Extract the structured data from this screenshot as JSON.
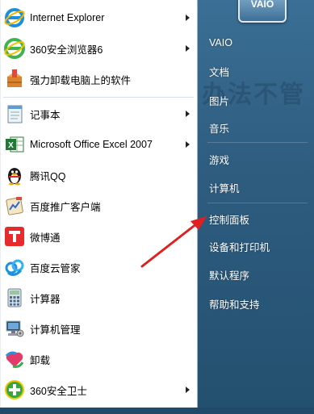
{
  "programs": [
    {
      "label": "Internet Explorer",
      "icon": "internet-explorer-icon",
      "arrow": true
    },
    {
      "label": "360安全浏览器6",
      "icon": "360-browser-icon",
      "arrow": true
    },
    {
      "label": "强力卸载电脑上的软件",
      "icon": "uninstall-box-icon",
      "arrow": false
    },
    {
      "label": "记事本",
      "icon": "notepad-icon",
      "arrow": true
    },
    {
      "label": "Microsoft Office Excel 2007",
      "icon": "excel-icon",
      "arrow": true
    },
    {
      "label": "腾讯QQ",
      "icon": "qq-penguin-icon",
      "arrow": false
    },
    {
      "label": "百度推广客户端",
      "icon": "baidu-promo-icon",
      "arrow": false
    },
    {
      "label": "微博通",
      "icon": "weibotong-icon",
      "arrow": false
    },
    {
      "label": "百度云管家",
      "icon": "baidu-cloud-icon",
      "arrow": false
    },
    {
      "label": "计算器",
      "icon": "calculator-icon",
      "arrow": false
    },
    {
      "label": "计算机管理",
      "icon": "computer-management-icon",
      "arrow": false
    },
    {
      "label": "卸载",
      "icon": "uninstall-heart-icon",
      "arrow": false
    },
    {
      "label": "360安全卫士",
      "icon": "360-safe-icon",
      "arrow": true
    }
  ],
  "right_panel": {
    "avatar_text": "VAIO",
    "items": [
      {
        "label": "VAIO"
      },
      {
        "label": "文档"
      },
      {
        "label": "图片"
      },
      {
        "label": "音乐"
      },
      {
        "label": "游戏"
      },
      {
        "label": "计算机"
      },
      {
        "label": "控制面板"
      },
      {
        "label": "设备和打印机"
      },
      {
        "label": "默认程序"
      },
      {
        "label": "帮助和支持"
      }
    ]
  },
  "background_text": "办法不管",
  "colors": {
    "menu_left_bg": "#ffffff",
    "menu_right_bg": "#2e5d80",
    "annotation_arrow": "#e02020"
  }
}
